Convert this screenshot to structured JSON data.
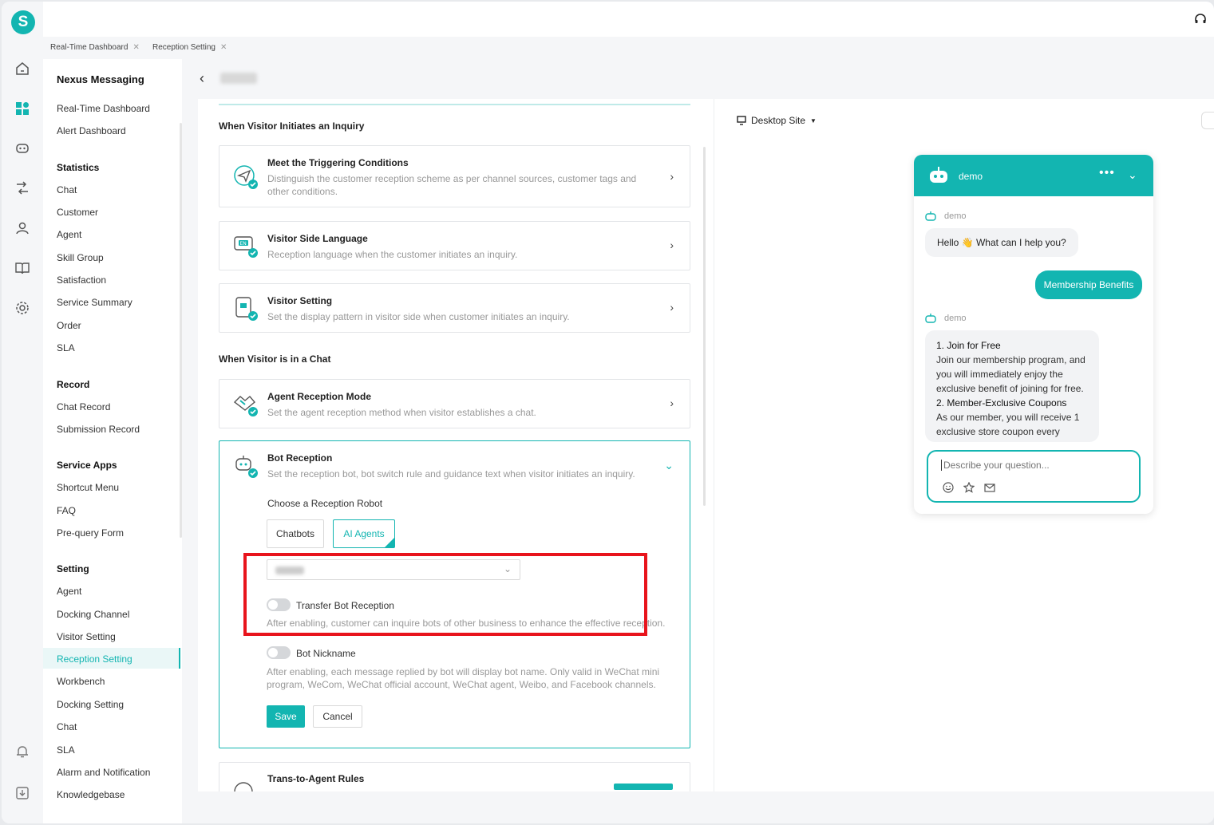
{
  "app": {
    "logo_letter": "S"
  },
  "tabs": [
    {
      "label": "Real-Time Dashboard"
    },
    {
      "label": "Reception Setting"
    }
  ],
  "nav": {
    "title": "Nexus Messaging",
    "groups": [
      {
        "items": [
          "Real-Time Dashboard",
          "Alert Dashboard"
        ]
      },
      {
        "heading": "Statistics",
        "items": [
          "Chat",
          "Customer",
          "Agent",
          "Skill Group",
          "Satisfaction",
          "Service Summary",
          "Order",
          "SLA"
        ]
      },
      {
        "heading": "Record",
        "items": [
          "Chat Record",
          "Submission Record"
        ]
      },
      {
        "heading": "Service Apps",
        "items": [
          "Shortcut Menu",
          "FAQ",
          "Pre-query Form"
        ]
      },
      {
        "heading": "Setting",
        "items": [
          "Agent",
          "Docking Channel",
          "Visitor Setting",
          "Reception Setting",
          "Workbench",
          "Docking Setting",
          "Chat",
          "SLA",
          "Alarm and Notification",
          "Knowledgebase"
        ]
      }
    ],
    "active_item": "Reception Setting"
  },
  "main": {
    "section_inquiry": "When Visitor Initiates an Inquiry",
    "section_chat": "When Visitor is in a Chat",
    "cards": {
      "triggering": {
        "title": "Meet the Triggering Conditions",
        "desc": "Distinguish the customer reception scheme as per channel sources, customer tags and other conditions."
      },
      "language": {
        "title": "Visitor Side Language",
        "desc": "Reception language when the customer initiates an inquiry."
      },
      "visitor_setting": {
        "title": "Visitor Setting",
        "desc": "Set the display pattern in visitor side when customer initiates an inquiry."
      },
      "agent_mode": {
        "title": "Agent Reception Mode",
        "desc": "Set the agent reception method when visitor establishes a chat."
      },
      "bot": {
        "title": "Bot Reception",
        "desc": "Set the reception bot, bot switch rule and guidance text when visitor initiates an inquiry."
      },
      "trans": {
        "title": "Trans-to-Agent Rules"
      }
    },
    "bot_reception": {
      "choose_label": "Choose a Reception Robot",
      "options": [
        "Chatbots",
        "AI Agents"
      ],
      "selected": "AI Agents",
      "transfer_label": "Transfer Bot Reception",
      "transfer_enabled": false,
      "transfer_hint": "After enabling, customer can inquire bots of other business to enhance the effective reception.",
      "nickname_label": "Bot Nickname",
      "nickname_enabled": false,
      "nickname_hint": "After enabling, each message replied by bot will display bot name. Only valid in WeChat mini program, WeCom, WeChat official account, WeChat agent, Weibo, and Facebook channels.",
      "save_label": "Save",
      "cancel_label": "Cancel"
    }
  },
  "preview": {
    "site_label": "Desktop Site",
    "chat_title": "demo",
    "bot_name": "demo",
    "greeting": "Hello 👋 What can I help you?",
    "user_msg": "Membership Benefits",
    "reply_lines": [
      {
        "text": "1. Join for Free",
        "strong": true
      },
      {
        "text": "Join our membership program, and you will immediately enjoy the exclusive benefit of joining for free.",
        "strong": false
      },
      {
        "text": "2. Member-Exclusive Coupons",
        "strong": true
      },
      {
        "text": "As our member, you will receive 1 exclusive store coupon every",
        "strong": false
      }
    ],
    "input_placeholder": "Describe your question...",
    "colors": {
      "accent": "#13b5b1",
      "highlight": "#e8141c"
    }
  }
}
